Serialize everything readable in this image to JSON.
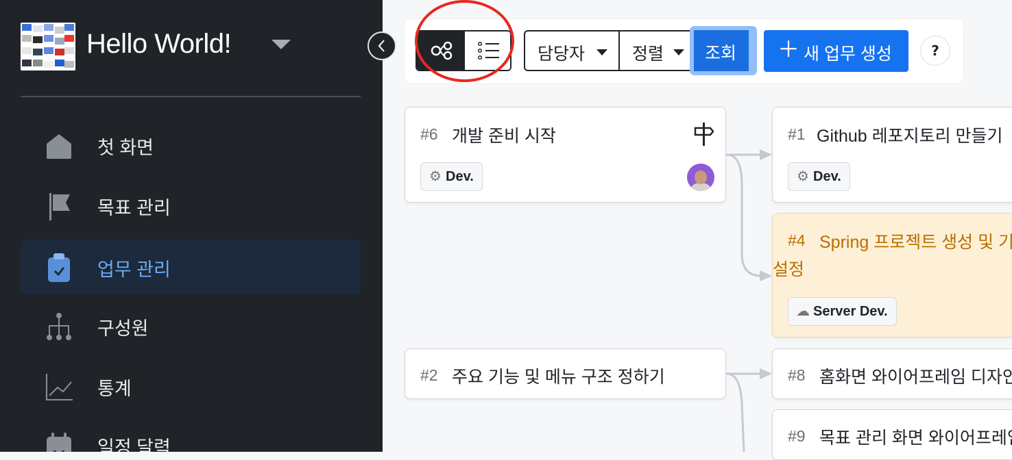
{
  "sidebar": {
    "workspace_title": "Hello World!",
    "nav": [
      {
        "label": "첫 화면",
        "icon": "home-icon",
        "active": false
      },
      {
        "label": "목표 관리",
        "icon": "flag-icon",
        "active": false
      },
      {
        "label": "업무 관리",
        "icon": "clipboard-check-icon",
        "active": true
      },
      {
        "label": "구성원",
        "icon": "org-chart-icon",
        "active": false
      },
      {
        "label": "통계",
        "icon": "line-chart-icon",
        "active": false
      },
      {
        "label": "일정 달력",
        "icon": "calendar-icon",
        "active": false
      }
    ]
  },
  "toolbar": {
    "view_modes": [
      {
        "name": "flow",
        "icon": "flow-view-icon",
        "active": true
      },
      {
        "name": "list",
        "icon": "list-view-icon",
        "active": false
      }
    ],
    "assignee_label": "담당자",
    "sort_label": "정렬",
    "search_label": "조회",
    "new_task_label": "새 업무 생성",
    "help_label": "?"
  },
  "tasks": [
    {
      "num": "#6",
      "title": "개발 준비 시작",
      "tag": "Dev.",
      "tag_icon": "gear-icon",
      "has_avatar": true,
      "milestone": true
    },
    {
      "num": "#1",
      "title": "Github 레포지토리 만들기",
      "tag": "Dev.",
      "tag_icon": "gear-icon"
    },
    {
      "num": "#4",
      "title": "Spring 프로젝트 생성 및 기",
      "title_line2": "설정",
      "tag": "Server Dev.",
      "tag_icon": "cloud-icon",
      "highlight": true
    },
    {
      "num": "#2",
      "title": "주요 기능 및 메뉴 구조 정하기"
    },
    {
      "num": "#8",
      "title": "홈화면 와이어프레임 디자인"
    },
    {
      "num": "#9",
      "title": "목표 관리 화면 와이어프레임"
    }
  ],
  "colors": {
    "sidebar_bg": "#202328",
    "accent": "#1673f0",
    "active_nav_text": "#6aaaf5",
    "warning_card_bg": "#fdf0d7",
    "annotation_circle": "#e8281e"
  }
}
